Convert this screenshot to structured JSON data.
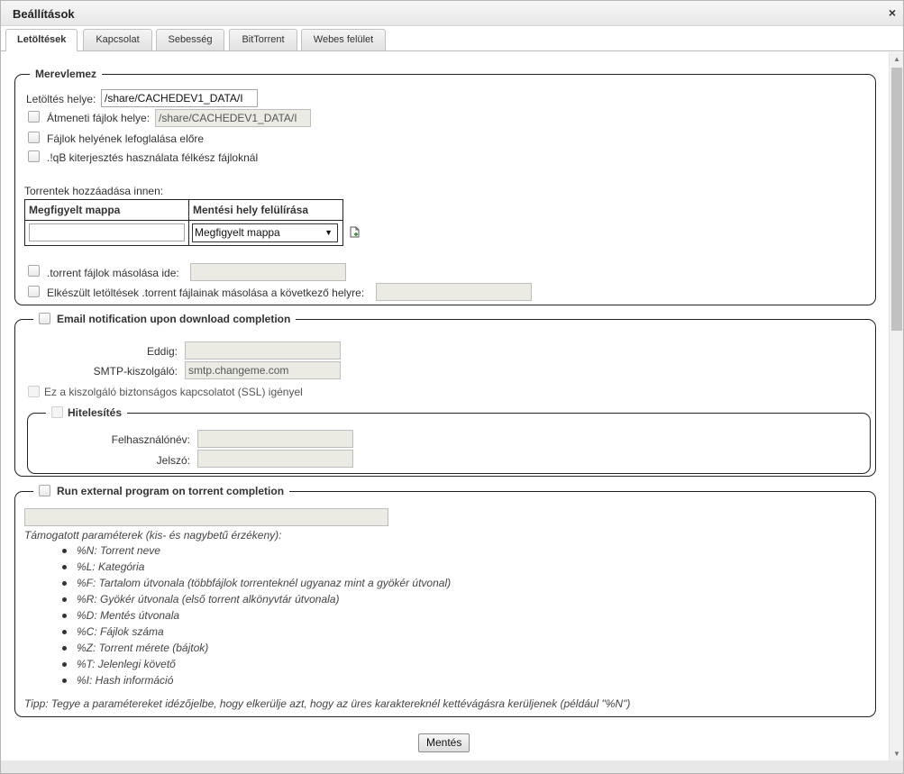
{
  "window": {
    "title": "Beállítások",
    "close_glyph": "×"
  },
  "tabs": [
    {
      "label": "Letöltések",
      "active": true
    },
    {
      "label": "Kapcsolat"
    },
    {
      "label": "Sebesség"
    },
    {
      "label": "BitTorrent"
    },
    {
      "label": "Webes felület"
    }
  ],
  "harddisk": {
    "legend": "Merevlemez",
    "download_location_label": "Letöltés helye:",
    "download_location_value": "/share/CACHEDEV1_DATA/I",
    "temp_files_label": "Átmeneti fájlok helye:",
    "temp_files_value": "/share/CACHEDEV1_DATA/I",
    "preallocate_label": "Fájlok helyének lefoglalása előre",
    "iqb_ext_label": ".!qB kiterjesztés használata félkész fájloknál",
    "add_from_label": "Torrentek hozzáadása innen:",
    "watch_table": {
      "col_watched": "Megfigyelt mappa",
      "col_override": "Mentési hely felülírása",
      "watched_value": "",
      "override_value": "Megfigyelt mappa"
    },
    "copy_torrent_label": ".torrent fájlok másolása ide:",
    "copy_finished_label": "Elkészült letöltések .torrent fájlainak másolása a következő helyre:"
  },
  "email": {
    "legend": "Email notification upon download completion",
    "to_label": "Eddig:",
    "to_value": "",
    "smtp_label": "SMTP-kiszolgáló:",
    "smtp_value": "smtp.changeme.com",
    "ssl_label": "Ez a kiszolgáló biztonságos kapcsolatot (SSL) igényel",
    "auth": {
      "legend": "Hitelesítés",
      "username_label": "Felhasználónév:",
      "password_label": "Jelszó:"
    }
  },
  "external": {
    "legend": "Run external program on torrent completion",
    "command_value": "",
    "supported_params": "Támogatott paraméterek (kis- és nagybetű érzékeny):",
    "params": [
      "%N: Torrent neve",
      "%L: Kategória",
      "%F: Tartalom útvonala (többfájlok torrenteknél ugyanaz mint a gyökér útvonal)",
      "%R: Gyökér útvonala (első torrent alkönyvtár útvonala)",
      "%D: Mentés útvonala",
      "%C: Fájlok száma",
      "%Z: Torrent mérete (bájtok)",
      "%T: Jelenlegi követő",
      "%I: Hash információ"
    ],
    "tip": "Tipp: Tegye a paramétereket idézőjelbe, hogy elkerülje azt, hogy az üres karaktereknél kettévágásra kerüljenek (például \"%N\")"
  },
  "save_button": "Mentés"
}
